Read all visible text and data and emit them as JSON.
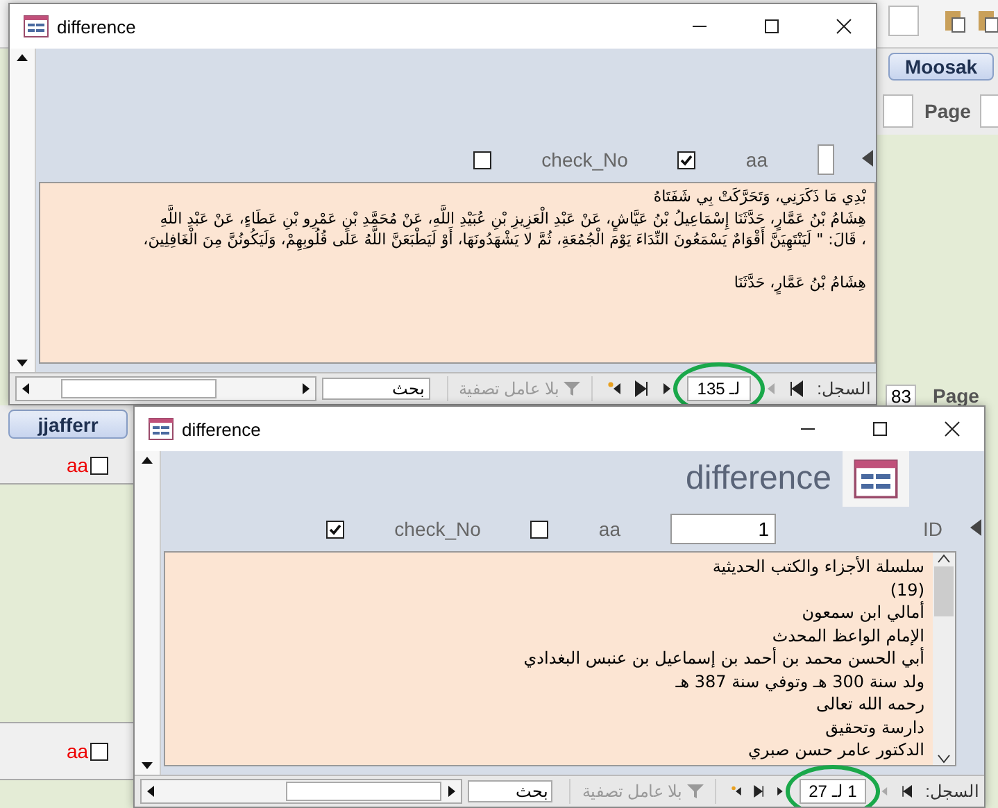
{
  "background": {
    "user_buttons": [
      "Moosak",
      "jjafferr"
    ],
    "page_labels": [
      "Page",
      "Page"
    ],
    "page_number": "83",
    "red_fields": [
      {
        "label": "aa",
        "checked": false
      },
      {
        "label": "aa",
        "checked": false
      }
    ]
  },
  "windows": [
    {
      "title": "difference",
      "memo_scrollbar": false,
      "fields": [
        {
          "kind": "textbox"
        },
        {
          "kind": "label",
          "text": "aa"
        },
        {
          "kind": "checkbox",
          "checked": true
        },
        {
          "kind": "label",
          "text": "check_No"
        },
        {
          "kind": "checkbox",
          "checked": false
        }
      ],
      "memo_paragraphs": [
        [
          "بْدِي مَا ذَكَرَنِي، وَتَحَرَّكَتْ بِي شَفَتَاهُ",
          "هِشَامُ بْنُ عَمَّارٍ، حَدَّثَنَا إِسْمَاعِيلُ بْنُ عَيَّاشٍ، عَنْ عَبْدِ الْعَزِيزِ بْنِ عُبَيْدِ اللَّهِ، عَنْ مُحَمَّدِ بْنِ عَمْرِو بْنِ عَطَاءٍ، عَنْ عَبْدِ اللَّهِ",
          "، قَالَ: \" لَيَنْتَهِيَنَّ أَقْوَامٌ يَسْمَعُونَ النِّدَاءَ يَوْمَ الْجُمُعَةِ، ثُمَّ لا يَشْهَدُونَهَا، أَوْ لَيَطْبَعَنَّ اللَّهُ عَلَى قُلُوبِهِمْ، وَلَيَكُونُنَّ مِنَ الْغَافِلِينَ،"
        ],
        [
          "هِشَامُ بْنُ عَمَّارٍ، حَدَّثَنَا"
        ]
      ],
      "navigation": {
        "label": "السجل:",
        "record": "لـ 135",
        "filter": "بلا عامل تصفية",
        "search": "بحث",
        "record_circled": true
      }
    },
    {
      "title": "difference",
      "header_title": "difference",
      "memo_scrollbar": true,
      "fields": [
        {
          "kind": "label",
          "text": "ID"
        },
        {
          "kind": "textbox",
          "value": "1"
        },
        {
          "kind": "label",
          "text": "aa"
        },
        {
          "kind": "checkbox",
          "checked": false
        },
        {
          "kind": "label",
          "text": "check_No"
        },
        {
          "kind": "checkbox",
          "checked": true
        }
      ],
      "memo_paragraphs": [
        [
          "سلسلة الأجزاء والكتب الحديثية",
          "(19)",
          "أمالي ابن سمعون",
          "الإمام الواعظ المحدث",
          "أبي الحسن محمد بن أحمد بن إسماعيل بن عنبس البغدادي",
          "ولد سنة 300 هـ وتوفي سنة 387 هـ",
          "رحمه الله تعالى",
          "دارسة وتحقيق",
          "الدكتور عامر حسن صبري"
        ]
      ],
      "navigation": {
        "label": "السجل:",
        "record": "1 لـ 27",
        "filter": "بلا عامل تصفية",
        "search": "بحث",
        "record_circled": true
      }
    }
  ]
}
